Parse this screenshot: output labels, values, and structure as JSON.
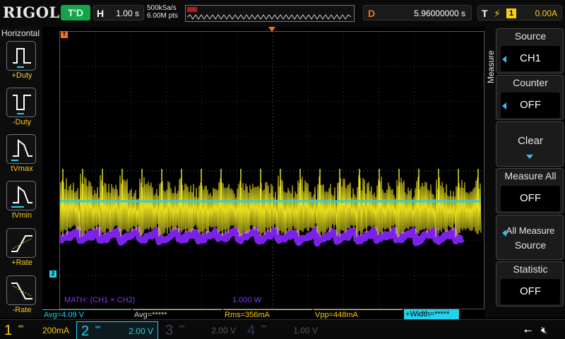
{
  "brand": "RIGOL",
  "header": {
    "trigger_status": "T'D",
    "horizontal_label": "H",
    "horizontal_scale": "1.00 s",
    "sample_rate": "500kSa/s",
    "memory_depth": "6.00M pts",
    "delay_label": "D",
    "delay_value": "5.96000000 s",
    "trigger_label": "T",
    "trigger_source": "1",
    "trigger_level": "0.00A"
  },
  "left_panel": {
    "title": "Horizontal",
    "items": [
      {
        "label": "+Duty",
        "icon": "positive-duty-icon"
      },
      {
        "label": "-Duty",
        "icon": "negative-duty-icon"
      },
      {
        "label": "tVmax",
        "icon": "time-at-vmax-icon"
      },
      {
        "label": "tVmin",
        "icon": "time-at-vmin-icon"
      },
      {
        "label": "+Rate",
        "icon": "positive-rate-icon"
      },
      {
        "label": "-Rate",
        "icon": "negative-rate-icon"
      }
    ]
  },
  "screen": {
    "math_label": "MATH: (CH1 × CH2)",
    "math_scale": "1.000 W",
    "ch2_marker": "2",
    "trigger_marker": "T"
  },
  "measurements": {
    "avg_ch2": "Avg=4.09 V",
    "avg_ch1": "Avg=*****",
    "rms": "Rms=356mA",
    "vpp": "Vpp=448mA",
    "width": "+Width=*****"
  },
  "menu": {
    "title": "Measure",
    "source_label": "Source",
    "source_value": "CH1",
    "counter_label": "Counter",
    "counter_value": "OFF",
    "clear_label": "Clear",
    "measure_all_label": "Measure All",
    "measure_all_value": "OFF",
    "all_measure_source_line1": "All Measure",
    "all_measure_source_line2": "Source",
    "statistic_label": "Statistic",
    "statistic_value": "OFF"
  },
  "channels": [
    {
      "num": "1",
      "scale": "200mA",
      "color": "#facc15"
    },
    {
      "num": "2",
      "scale": "2.00 V",
      "color": "#22d3ee"
    },
    {
      "num": "3",
      "scale": "2.00 V",
      "color": "#a855f7"
    },
    {
      "num": "4",
      "scale": "1.00 V",
      "color": "#3b82f6"
    }
  ],
  "colors": {
    "ch1": "#e8e020",
    "ch2": "#22d3ee",
    "math": "#7c22e8",
    "trigger": "#f97316"
  }
}
